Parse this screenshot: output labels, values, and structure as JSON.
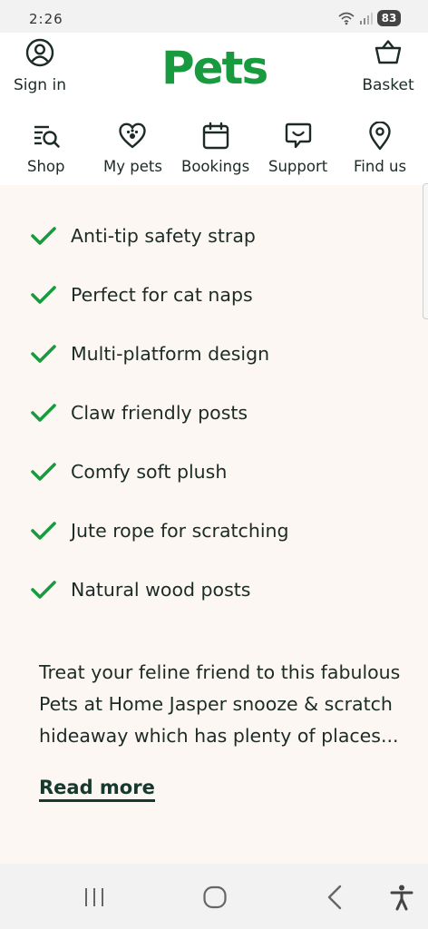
{
  "status_bar": {
    "time": "2:26",
    "battery": "83",
    "icons": [
      "wifi-icon",
      "signal-icon",
      "battery-icon"
    ]
  },
  "header": {
    "sign_in_label": "Sign in",
    "logo_text": "Pets",
    "basket_label": "Basket",
    "brand_color": "#179b3e"
  },
  "nav": {
    "items": [
      {
        "label": "Shop",
        "icon": "search-list-icon"
      },
      {
        "label": "My pets",
        "icon": "heart-icon"
      },
      {
        "label": "Bookings",
        "icon": "calendar-icon"
      },
      {
        "label": "Support",
        "icon": "chat-bubble-icon"
      },
      {
        "label": "Find us",
        "icon": "location-pin-icon"
      }
    ]
  },
  "features": [
    "Anti-tip safety strap",
    "Perfect for cat naps",
    "Multi-platform design",
    "Claw friendly posts",
    "Comfy soft plush",
    "Jute rope for scratching",
    "Natural wood posts"
  ],
  "description": "Treat your feline friend to this fabulous Pets at Home Jasper snooze & scratch hideaway which has plenty of places...",
  "read_more_label": "Read more",
  "colors": {
    "check": "#179b3e",
    "content_bg": "#fdf7f3",
    "text": "#1c2b26"
  },
  "android_nav": [
    "recent-apps-icon",
    "home-icon",
    "back-icon",
    "accessibility-icon"
  ]
}
